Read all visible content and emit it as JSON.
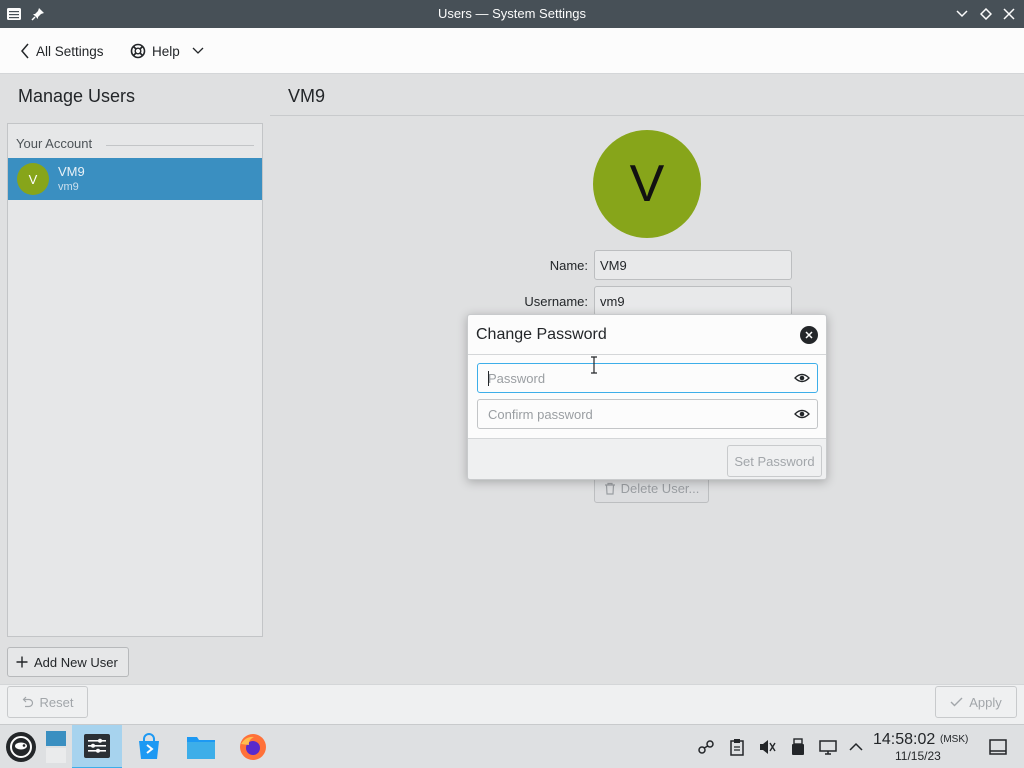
{
  "window": {
    "title": "Users — System Settings"
  },
  "toolbar": {
    "back_label": "All Settings",
    "help_label": "Help"
  },
  "page": {
    "heading": "Manage Users",
    "user_heading": "VM9"
  },
  "user_list": {
    "section": "Your Account",
    "users": [
      {
        "initial": "V",
        "name": "VM9",
        "login": "vm9"
      }
    ]
  },
  "user_detail": {
    "avatar_initial": "V",
    "name_label": "Name:",
    "name_value": "VM9",
    "username_label": "Username:",
    "username_value": "vm9",
    "delete_label": "Delete User..."
  },
  "actions": {
    "add_user": "Add New User",
    "reset": "Reset",
    "apply": "Apply"
  },
  "dialog": {
    "title": "Change Password",
    "password_placeholder": "Password",
    "confirm_placeholder": "Confirm password",
    "submit": "Set Password"
  },
  "clock": {
    "time": "14:58:02",
    "tz": "(MSK)",
    "date": "11/15/23"
  },
  "colors": {
    "accent": "#3daee9",
    "selection": "#3a8fc1",
    "avatar": "#87a51a",
    "titlebar": "#475057"
  }
}
